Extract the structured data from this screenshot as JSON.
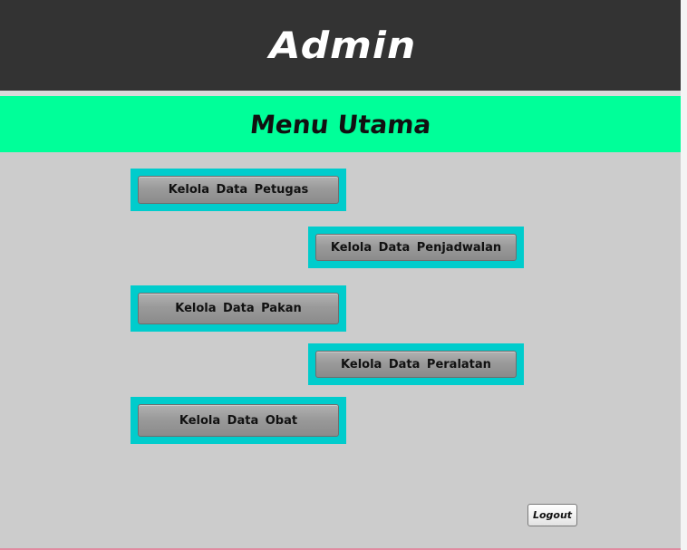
{
  "header": {
    "title": "Admin"
  },
  "menu": {
    "title": "Menu Utama",
    "buttons": [
      {
        "label": "Kelola  Data  Petugas"
      },
      {
        "label": "Kelola  Data  Penjadwalan"
      },
      {
        "label": "Kelola  Data  Pakan"
      },
      {
        "label": "Kelola  Data  Peralatan"
      },
      {
        "label": "Kelola  Data  Obat"
      }
    ]
  },
  "footer": {
    "logout_label": "Logout"
  },
  "colors": {
    "header_bg": "#333333",
    "menu_band_bg": "#00ff99",
    "button_frame": "#00cccc",
    "window_bg": "#cccccc"
  }
}
